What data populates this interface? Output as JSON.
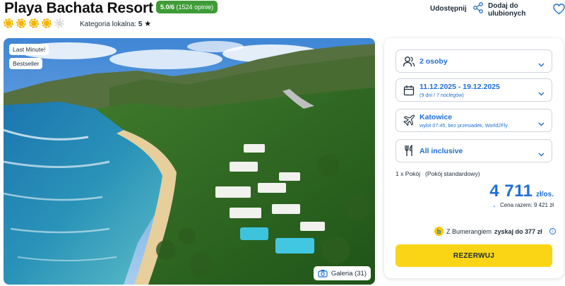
{
  "header": {
    "title": "Playa Bachata Resort",
    "rating_score": "5.0/6",
    "rating_count": "(1524 opinie)",
    "sun_rating": 4,
    "sun_max": 5,
    "local_category_label": "Kategoria lokalna:",
    "local_category_value": "5",
    "share_label": "Udostępnij",
    "favorite_label": "Dodaj do ulubionych",
    "icons": [
      "sun-icon",
      "star-icon",
      "share-icon",
      "heart-icon"
    ]
  },
  "photo": {
    "tags": [
      "Last Minute!",
      "Bestseller"
    ],
    "gallery_label": "Galeria (31)"
  },
  "booking": {
    "guests": "2 osoby",
    "dates": "11.12.2025 - 19.12.2025",
    "dates_sub": "(9 dni / 7 noclegów)",
    "departure_city": "Katowice",
    "departure_sub": "wylot 07:45, bez przesiadek, World2Fly",
    "board": "All inclusive",
    "room": "1 x Pokój   (Pokój standardowy)",
    "price": "4 711",
    "price_unit": "zł/os.",
    "total_label": "Cena razem: 9 421 zł",
    "bonus_prefix": "Z Bumerangiem",
    "bonus_highlight": "zyskaj do 377 zł",
    "book_label": "REZERWUJ"
  },
  "colors": {
    "accent_blue": "#1f6ed4",
    "rating_green": "#3e9c35",
    "book_yellow": "#f9d515",
    "sun_yellow": "#f5b400"
  }
}
